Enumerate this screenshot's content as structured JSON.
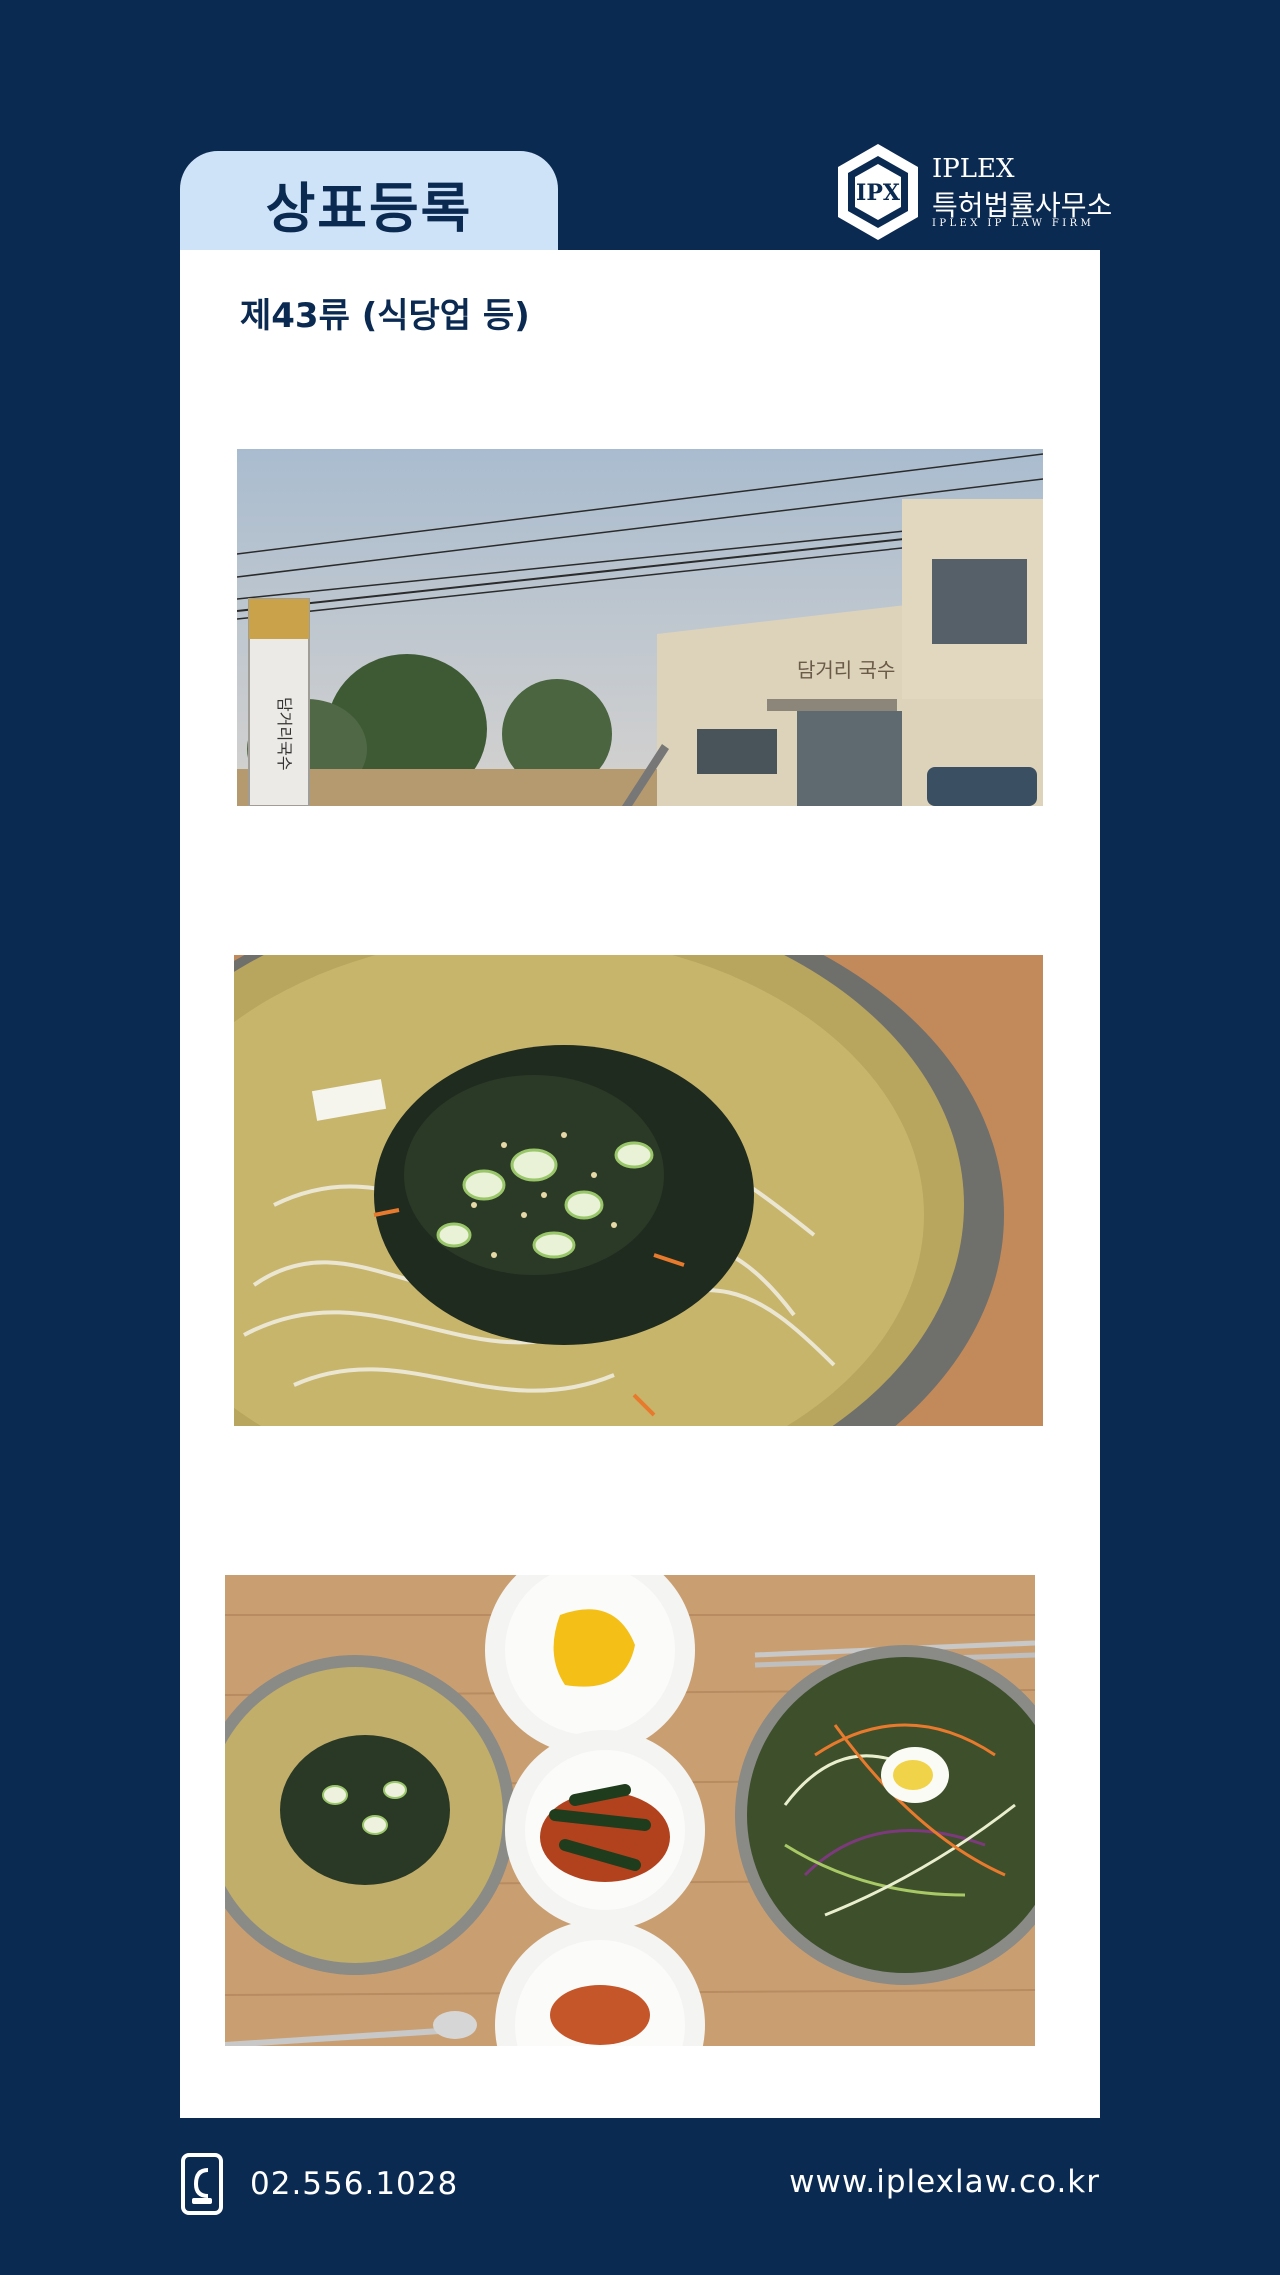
{
  "header": {
    "tab_label": "상표등록",
    "logo": {
      "name_en": "IPLEX",
      "name_kr": "특허법률사무소",
      "tagline": "IPLEX IP LAW FIRM"
    }
  },
  "card": {
    "subtitle": "제43류 (식당업 등)",
    "photos": [
      {
        "icon": "restaurant-exterior-photo",
        "sign_text": "담거리국수"
      },
      {
        "icon": "noodle-bowl-photo"
      },
      {
        "icon": "meal-set-photo"
      }
    ]
  },
  "footer": {
    "phone": "02.556.1028",
    "website": "www.iplexlaw.co.kr"
  },
  "colors": {
    "background": "#0b2a52",
    "tab": "#cfe3f8",
    "card": "#ffffff"
  }
}
